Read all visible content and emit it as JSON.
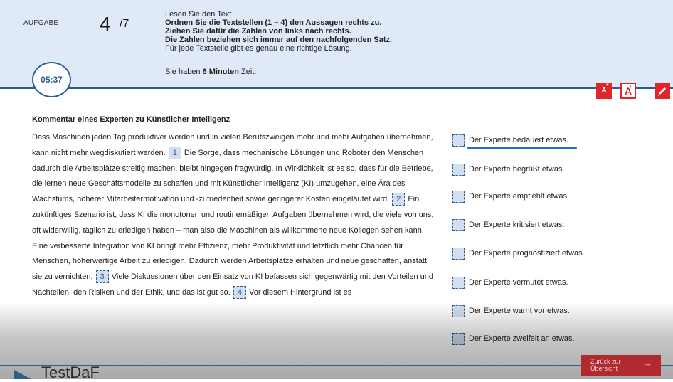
{
  "header": {
    "aufgabe_label": "AUFGABE",
    "task_number": "4",
    "task_total": "/7",
    "instructions": [
      "Lesen Sie den Text.",
      "Ordnen Sie die Textstellen (1 – 4) den Aussagen rechts zu.",
      "Ziehen Sie dafür die Zahlen von links nach rechts.",
      "Die Zahlen beziehen sich immer auf den nachfolgenden Satz.",
      "Für jede Textstelle gibt es genau eine richtige Lösung."
    ],
    "time_prefix": "Sie haben ",
    "time_value": "6 Minuten",
    "time_suffix": " Zeit."
  },
  "timer": "05:37",
  "toolbar": {
    "font_smaller": "A",
    "font_larger": "A"
  },
  "text": {
    "title": "Kommentar eines Experten zu Künstlicher Intelligenz",
    "seg1": "Dass Maschinen jeden Tag produktiver werden und in vielen Berufszweigen mehr und mehr Aufgaben übernehmen, kann nicht mehr wegdiskutiert werden.",
    "gap1": "1",
    "seg2": "Die Sorge, dass mechanische Lösungen und Roboter den Menschen dadurch die Arbeitsplätze streitig machen, bleibt hingegen fragwürdig. In Wirklichkeit ist es so, dass für die Betriebe, die lernen neue Geschäftsmodelle zu schaffen und mit Künstlicher Intelligenz (KI) umzugehen, eine Ära des Wachstums, höherer Mitarbeitermotivation und -zufriedenheit sowie geringerer Kosten eingeläutet wird.",
    "gap2": "2",
    "seg3": "Ein zukünftiges Szenario ist, dass KI die monotonen und routinemäßigen Aufgaben übernehmen wird, die viele von uns, oft widerwillig, täglich zu erledigen haben – man also die Maschinen als willkommene neue Kollegen sehen kann. Eine verbesserte Integration von KI bringt mehr Effizienz, mehr Produktivität und letztlich mehr Chancen für Menschen, höherwertige Arbeit zu erledigen. Dadurch werden Arbeitsplätze erhalten und neue geschaffen, anstatt sie zu vernichten.",
    "gap3": "3",
    "seg4": "Viele Diskussionen über den Einsatz von KI befassen sich gegenwärtig mit den Vorteilen und Nachteilen, den Risiken und der Ethik, und das ist gut so.",
    "gap4": "4",
    "seg5": "Vor diesem Hintergrund ist es"
  },
  "statements": [
    "Der Experte bedauert etwas.",
    "Der Experte begrüßt etwas.",
    "Der Experte empfiehlt etwas.",
    "Der Experte kritisiert etwas.",
    "Der Experte prognostiziert etwas.",
    "Der Experte vermutet etwas.",
    "Der Experte warnt vor etwas.",
    "Der Experte zweifelt an etwas."
  ],
  "footer": {
    "logo": "TestDaF",
    "back_line1": "Zurück zur",
    "back_line2": "Übersicht",
    "back_arrow": "→"
  },
  "colors": {
    "header_bg": "#dfe9f7",
    "primary_blue": "#2d5f8c",
    "tool_red": "#e0262a",
    "back_button": "#b02a30",
    "highlight_underline": "#1f72bf"
  }
}
